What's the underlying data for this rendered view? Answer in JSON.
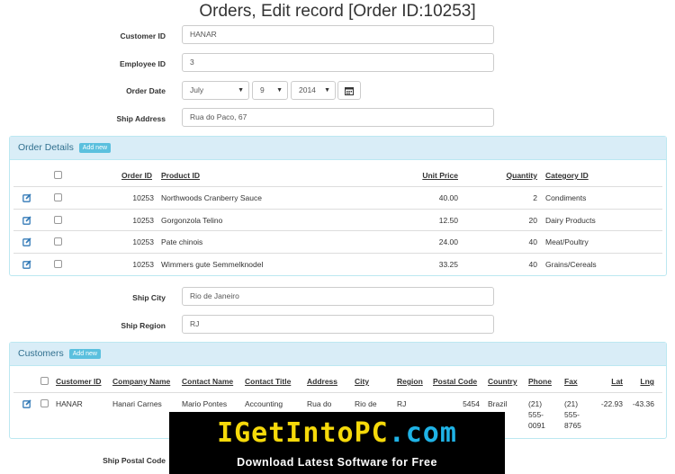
{
  "page": {
    "title": "Orders, Edit record [Order ID:10253]"
  },
  "form": {
    "customer_id": {
      "label": "Customer ID",
      "value": "HANAR"
    },
    "employee_id": {
      "label": "Employee ID",
      "value": "3"
    },
    "order_date": {
      "label": "Order Date",
      "month": "July",
      "day": "9",
      "year": "2014"
    },
    "ship_address": {
      "label": "Ship Address",
      "value": "Rua do Paco, 67"
    },
    "ship_city": {
      "label": "Ship City",
      "value": "Rio de Janeiro"
    },
    "ship_region": {
      "label": "Ship Region",
      "value": "RJ"
    },
    "ship_postal_code": {
      "label": "Ship Postal Code"
    }
  },
  "order_details": {
    "title": "Order Details",
    "add_label": "Add new",
    "columns": {
      "order_id": "Order ID",
      "product_id": "Product ID",
      "unit_price": "Unit Price",
      "quantity": "Quantity",
      "category_id": "Category ID"
    },
    "rows": [
      {
        "order_id": "10253",
        "product": "Northwoods Cranberry Sauce",
        "unit_price": "40.00",
        "quantity": "2",
        "category": "Condiments"
      },
      {
        "order_id": "10253",
        "product": "Gorgonzola Telino",
        "unit_price": "12.50",
        "quantity": "20",
        "category": "Dairy Products"
      },
      {
        "order_id": "10253",
        "product": "Pate chinois",
        "unit_price": "24.00",
        "quantity": "40",
        "category": "Meat/Poultry"
      },
      {
        "order_id": "10253",
        "product": "Wimmers gute Semmelknodel",
        "unit_price": "33.25",
        "quantity": "40",
        "category": "Grains/Cereals"
      }
    ]
  },
  "customers": {
    "title": "Customers",
    "add_label": "Add new",
    "columns": {
      "customer_id": "Customer ID",
      "company_name": "Company Name",
      "contact_name": "Contact Name",
      "contact_title": "Contact Title",
      "address": "Address",
      "city": "City",
      "region": "Region",
      "postal_code": "Postal Code",
      "country": "Country",
      "phone": "Phone",
      "fax": "Fax",
      "lat": "Lat",
      "lng": "Lng"
    },
    "rows": [
      {
        "customer_id": "HANAR",
        "company_name": "Hanari Carnes",
        "contact_name": "Mario Pontes",
        "contact_title": "Accounting",
        "address": "Rua do",
        "city": "Rio de",
        "region": "RJ",
        "postal_code": "5454",
        "country": "Brazil",
        "phone_1": "(21)",
        "phone_2": "555-",
        "phone_3": "0091",
        "fax_1": "(21)",
        "fax_2": "555-",
        "fax_3": "8765",
        "lat": "-22.93",
        "lng": "-43.36"
      }
    ]
  },
  "banner": {
    "logo_part1": "IGetInto",
    "logo_part2": "PC",
    "logo_part3": ".com",
    "tagline": "Download Latest Software for Free"
  },
  "colors": {
    "panel_head_bg": "#d9edf7",
    "accent": "#5bc0de",
    "banner_yellow": "#f5d90a",
    "banner_cyan": "#1fb3e6",
    "edit_icon": "#337ab7"
  }
}
